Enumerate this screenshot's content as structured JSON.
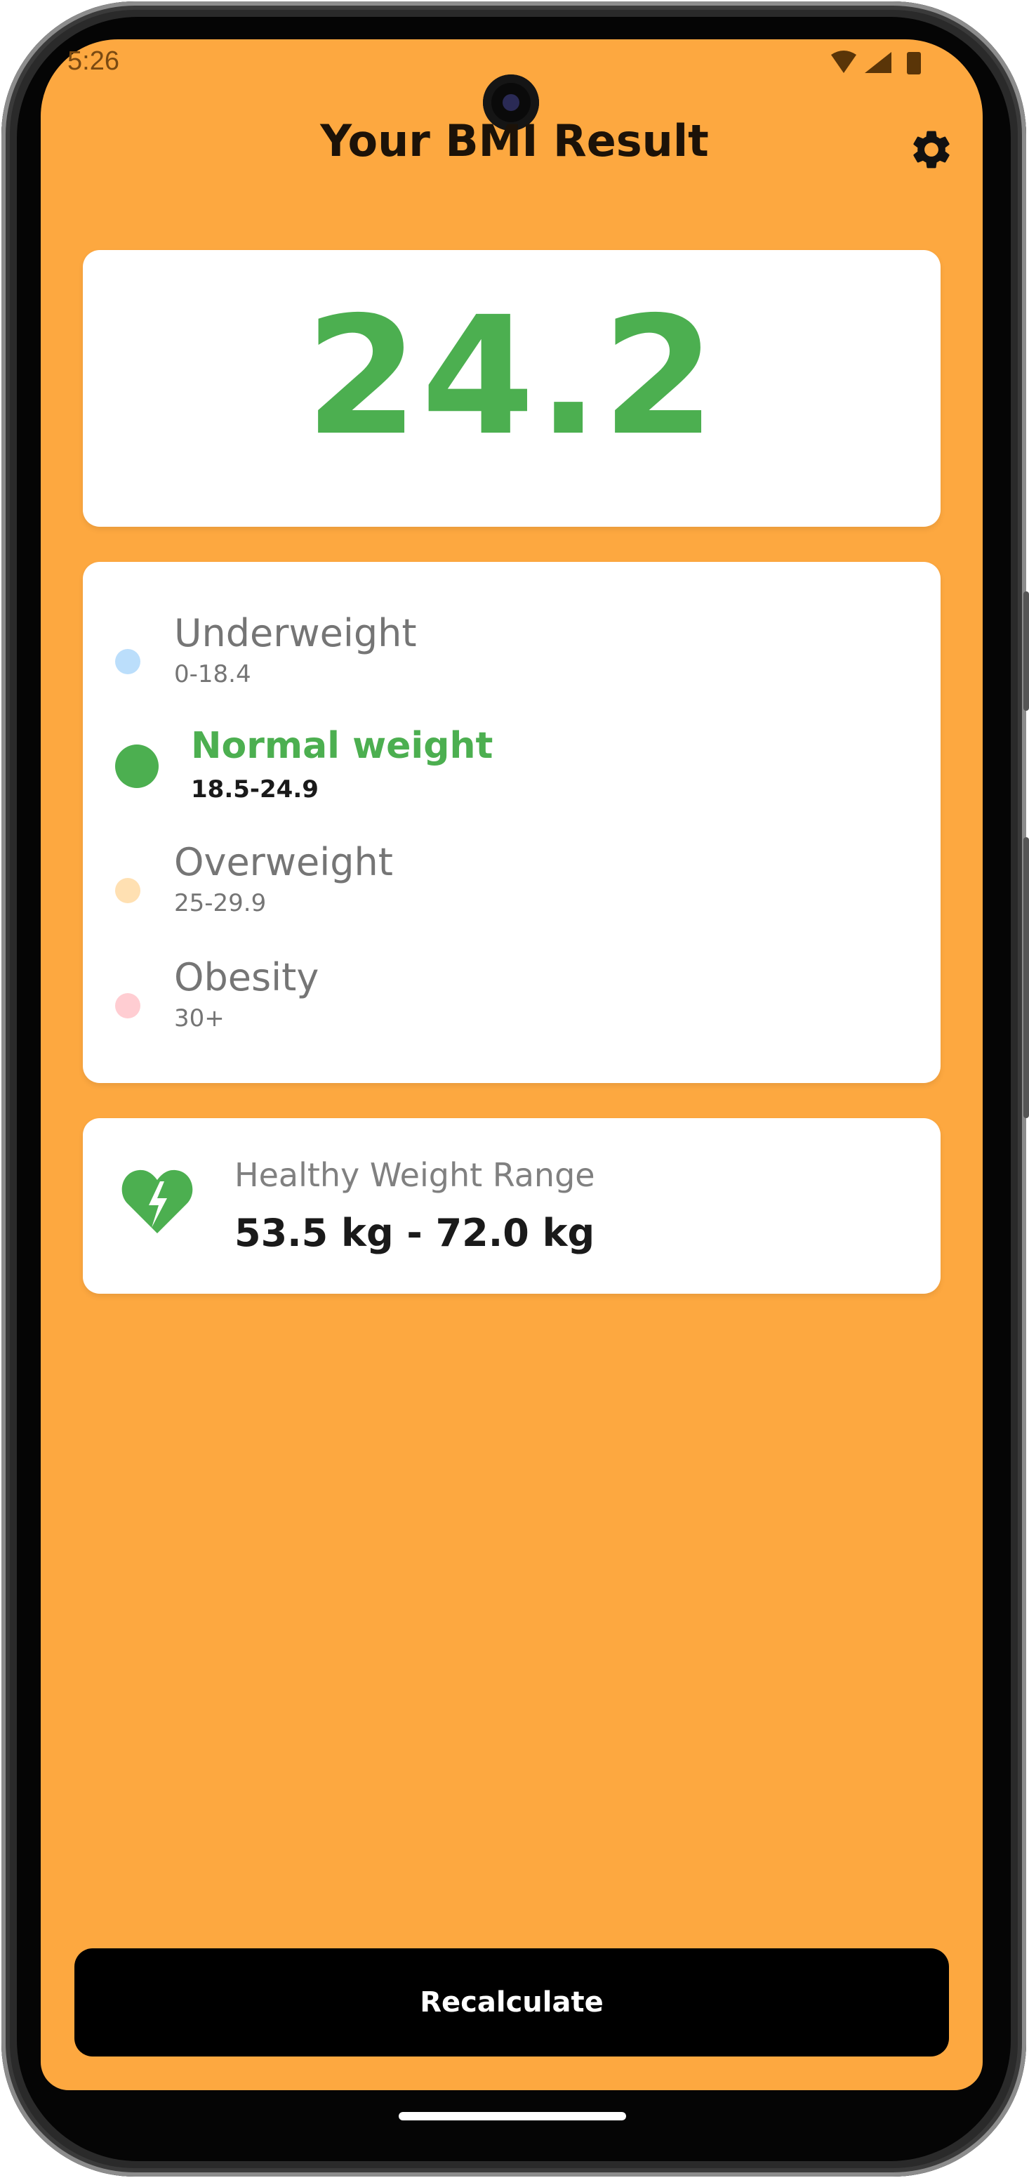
{
  "status_bar": {
    "time": "5:26",
    "icons": [
      "wifi-icon",
      "cellular-signal-icon",
      "battery-icon"
    ]
  },
  "header": {
    "title": "Your BMI Result",
    "settings_icon": "gear-icon"
  },
  "result": {
    "bmi": "24.2",
    "color": "#4CAF50"
  },
  "categories": [
    {
      "name": "Underweight",
      "range": "0-18.4",
      "color": "#BBDEFB",
      "active": false
    },
    {
      "name": "Normal weight",
      "range": "18.5-24.9",
      "color": "#4CAF50",
      "active": true
    },
    {
      "name": "Overweight",
      "range": "25-29.9",
      "color": "#FFE0B2",
      "active": false
    },
    {
      "name": "Obesity",
      "range": "30+",
      "color": "#FFCDD2",
      "active": false
    }
  ],
  "healthy_range": {
    "label": "Healthy Weight Range",
    "value": "53.5 kg - 72.0 kg",
    "icon": "heart-broken-icon"
  },
  "actions": {
    "recalculate_label": "Recalculate"
  },
  "colors": {
    "background": "#FDA840",
    "card": "#FFFFFF",
    "accent": "#4CAF50",
    "button": "#000000"
  }
}
